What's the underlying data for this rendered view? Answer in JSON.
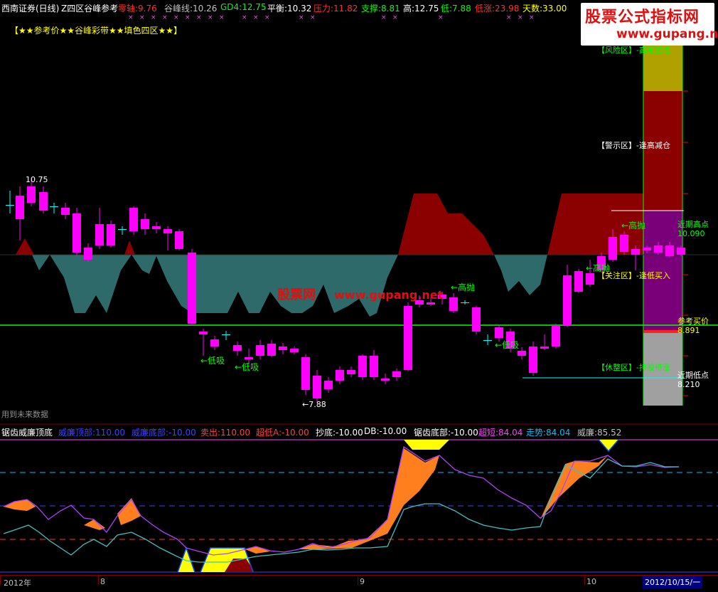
{
  "topbar": {
    "app": "西南证券(日线)",
    "formula": "Z四区谷峰参考",
    "items": [
      {
        "label": "零轴:",
        "value": "9.76",
        "color": "#ff3030"
      },
      {
        "label": "谷峰线:",
        "value": "10.26",
        "color": "#c0c0c0"
      },
      {
        "label": "GD4:",
        "value": "12.75",
        "color": "#00ff00"
      },
      {
        "label": "平衡:",
        "value": "10.32",
        "color": "#ffffff"
      },
      {
        "label": "压力:",
        "value": "11.82",
        "color": "#ff3030"
      },
      {
        "label": "支撑:",
        "value": "8.81",
        "color": "#00ff00"
      },
      {
        "label": "高:",
        "value": "12.75",
        "color": "#ffffff"
      },
      {
        "label": "低:",
        "value": "7.88",
        "color": "#00ff00"
      },
      {
        "label": "低涨:",
        "value": "23.98",
        "color": "#ff3030"
      },
      {
        "label": "天数:",
        "value": "33.00",
        "color": "#ffff00"
      }
    ]
  },
  "banner": "【★★参考价★★谷峰彩带★★填色四区★★】",
  "zones": {
    "risk": "【风险区】-高抛避险",
    "warn": "【警示区】-逢高减仓",
    "focus": "【关注区】-逢低买入",
    "rest": "【休整区】-持股待涨"
  },
  "right_labels": {
    "recent_high": "近期高点",
    "recent_high_val": "10.090",
    "ref_buy": "参考买价",
    "ref_buy_val": "8.891",
    "recent_low": "近期低点",
    "recent_low_val": "8.210"
  },
  "annotations": {
    "high_price": "10.75",
    "low_price": "←7.88",
    "buy1": "←低吸",
    "buy2": "←低吸",
    "buy3": "←低吸",
    "sell1": "←高抛",
    "sell2": "←高抛",
    "sell3": "←高抛"
  },
  "future_note": "用到未来数据",
  "watermark": {
    "cn": "股票网",
    "url": "www.gupang.net",
    "logo_big": "股票公式指标网",
    "logo_small": "www.gupang.net"
  },
  "indicator": {
    "name": "锯齿威廉顶底",
    "items": [
      {
        "label": "威廉顶部:",
        "value": "110.00",
        "color": "#4040ff"
      },
      {
        "label": "威廉底部:",
        "value": "-10.00",
        "color": "#4040ff"
      },
      {
        "label": "卖出:",
        "value": "110.00",
        "color": "#ff4040"
      },
      {
        "label": "超低A:",
        "value": "-10.00",
        "color": "#ff4040"
      },
      {
        "label": "抄底:",
        "value": "-10.00",
        "color": "#ffffff"
      },
      {
        "label": "DB:",
        "value": "-10.00",
        "color": "#ffffff"
      },
      {
        "label": "锯齿底部:",
        "value": "-10.00",
        "color": "#ffffff"
      },
      {
        "label": "超短:",
        "value": "84.04",
        "color": "#ff40ff"
      },
      {
        "label": "走势:",
        "value": "84.04",
        "color": "#00c0ff"
      },
      {
        "label": "威廉:",
        "value": "85.52",
        "color": "#c0c0c0"
      }
    ]
  },
  "date_axis": {
    "y2012": "2012年",
    "m8": "8",
    "m9": "9",
    "m10": "10",
    "cursor": "2012/10/15/一"
  },
  "colors": {
    "up": "#ff00ff",
    "down": "#00ffff",
    "risk": "#b0a000",
    "warn": "#8b0000",
    "focus": "#7a007a",
    "rest": "#a0a0a0",
    "ref": "#00ff00"
  }
}
